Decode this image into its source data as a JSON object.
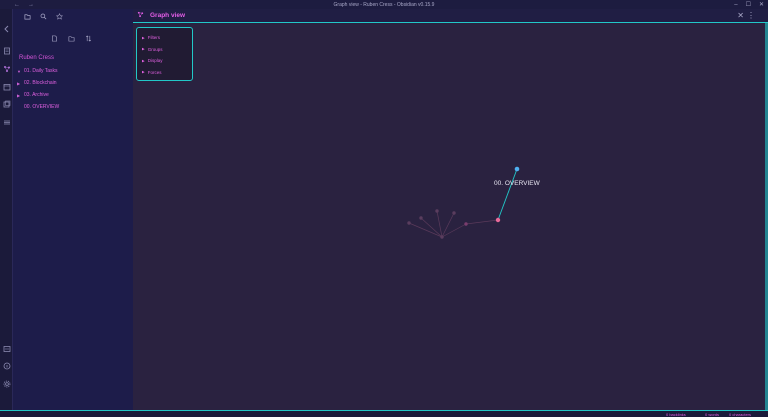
{
  "window": {
    "title": "Graph view - Ruben Cress - Obsidian v0.15.9",
    "back": "←",
    "forward": "→",
    "minimize": "–",
    "maximize": "☐",
    "close": "✕"
  },
  "sidebar": {
    "vault_name": "Ruben Cress",
    "tree": [
      {
        "label": "01. Daily Tasks",
        "arrow": "▼"
      },
      {
        "label": "02. Blockchain",
        "arrow": "▶"
      },
      {
        "label": "03. Archive",
        "arrow": "▶"
      },
      {
        "label": "00. OVERVIEW",
        "arrow": ""
      }
    ]
  },
  "tab": {
    "title": "Graph view",
    "close": "✕",
    "more": "⋮"
  },
  "graph_controls": [
    {
      "label": "Filters"
    },
    {
      "label": "Groups"
    },
    {
      "label": "Display"
    },
    {
      "label": "Forces"
    }
  ],
  "graph": {
    "node_label": "00. OVERVIEW"
  },
  "status": {
    "backlinks": "0 backlinks",
    "words": "0 words",
    "characters": "0 characters"
  },
  "colors": {
    "accent": "#e55ee8",
    "border": "#22c8c8",
    "node_blue": "#4fb0f0",
    "node_pink": "#e86a9a"
  }
}
